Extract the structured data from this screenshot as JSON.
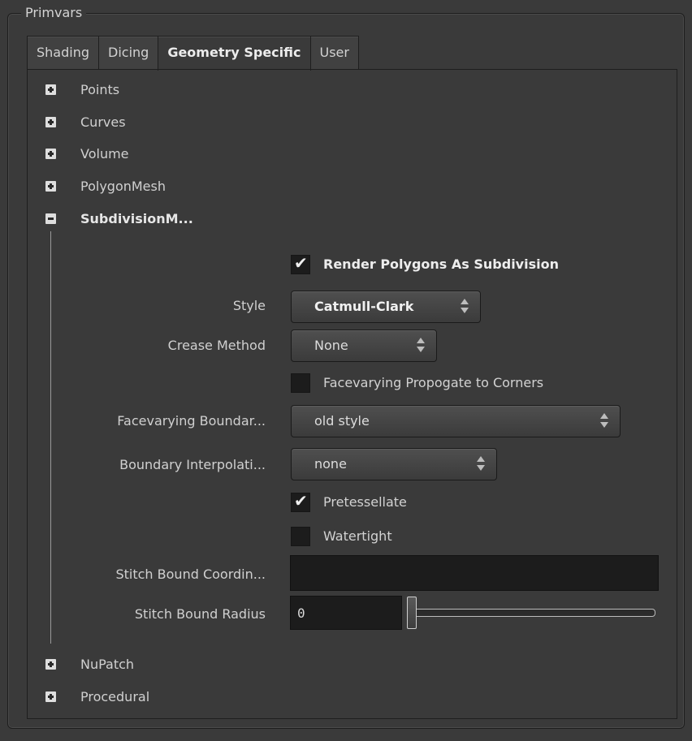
{
  "group_title": "Primvars",
  "tabs": [
    {
      "label": "Shading",
      "active": false
    },
    {
      "label": "Dicing",
      "active": false
    },
    {
      "label": "Geometry Specific",
      "active": true
    },
    {
      "label": "User",
      "active": false
    }
  ],
  "tree": [
    {
      "label": "Points",
      "expanded": false
    },
    {
      "label": "Curves",
      "expanded": false
    },
    {
      "label": "Volume",
      "expanded": false
    },
    {
      "label": "PolygonMesh",
      "expanded": false
    },
    {
      "label": "SubdivisionM...",
      "expanded": true
    },
    {
      "label": "NuPatch",
      "expanded": false
    },
    {
      "label": "Procedural",
      "expanded": false
    }
  ],
  "params": {
    "render_polygons": {
      "label": "Render Polygons As Subdivision",
      "checked": true
    },
    "style": {
      "label": "Style",
      "value": "Catmull-Clark"
    },
    "crease_method": {
      "label": "Crease Method",
      "value": "None"
    },
    "facevarying_propagate": {
      "label": "Facevarying Propogate to Corners",
      "checked": false
    },
    "facevarying_boundary": {
      "label": "Facevarying Boundar...",
      "value": "old style"
    },
    "boundary_interpolation": {
      "label": "Boundary Interpolati...",
      "value": "none"
    },
    "pretessellate": {
      "label": "Pretessellate",
      "checked": true
    },
    "watertight": {
      "label": "Watertight",
      "checked": false
    },
    "stitch_bound_coordinates": {
      "label": "Stitch Bound Coordin...",
      "value": ""
    },
    "stitch_bound_radius": {
      "label": "Stitch Bound Radius",
      "value": "0"
    }
  },
  "icons": {
    "check": "checkmark-icon",
    "expand": "plus-box-icon",
    "collapse": "minus-box-icon",
    "menu_arrows": "up-down-arrows-icon"
  },
  "colors": {
    "background": "#3a3a3a",
    "field": "#1c1c1c",
    "text": "#d0d0d0"
  }
}
